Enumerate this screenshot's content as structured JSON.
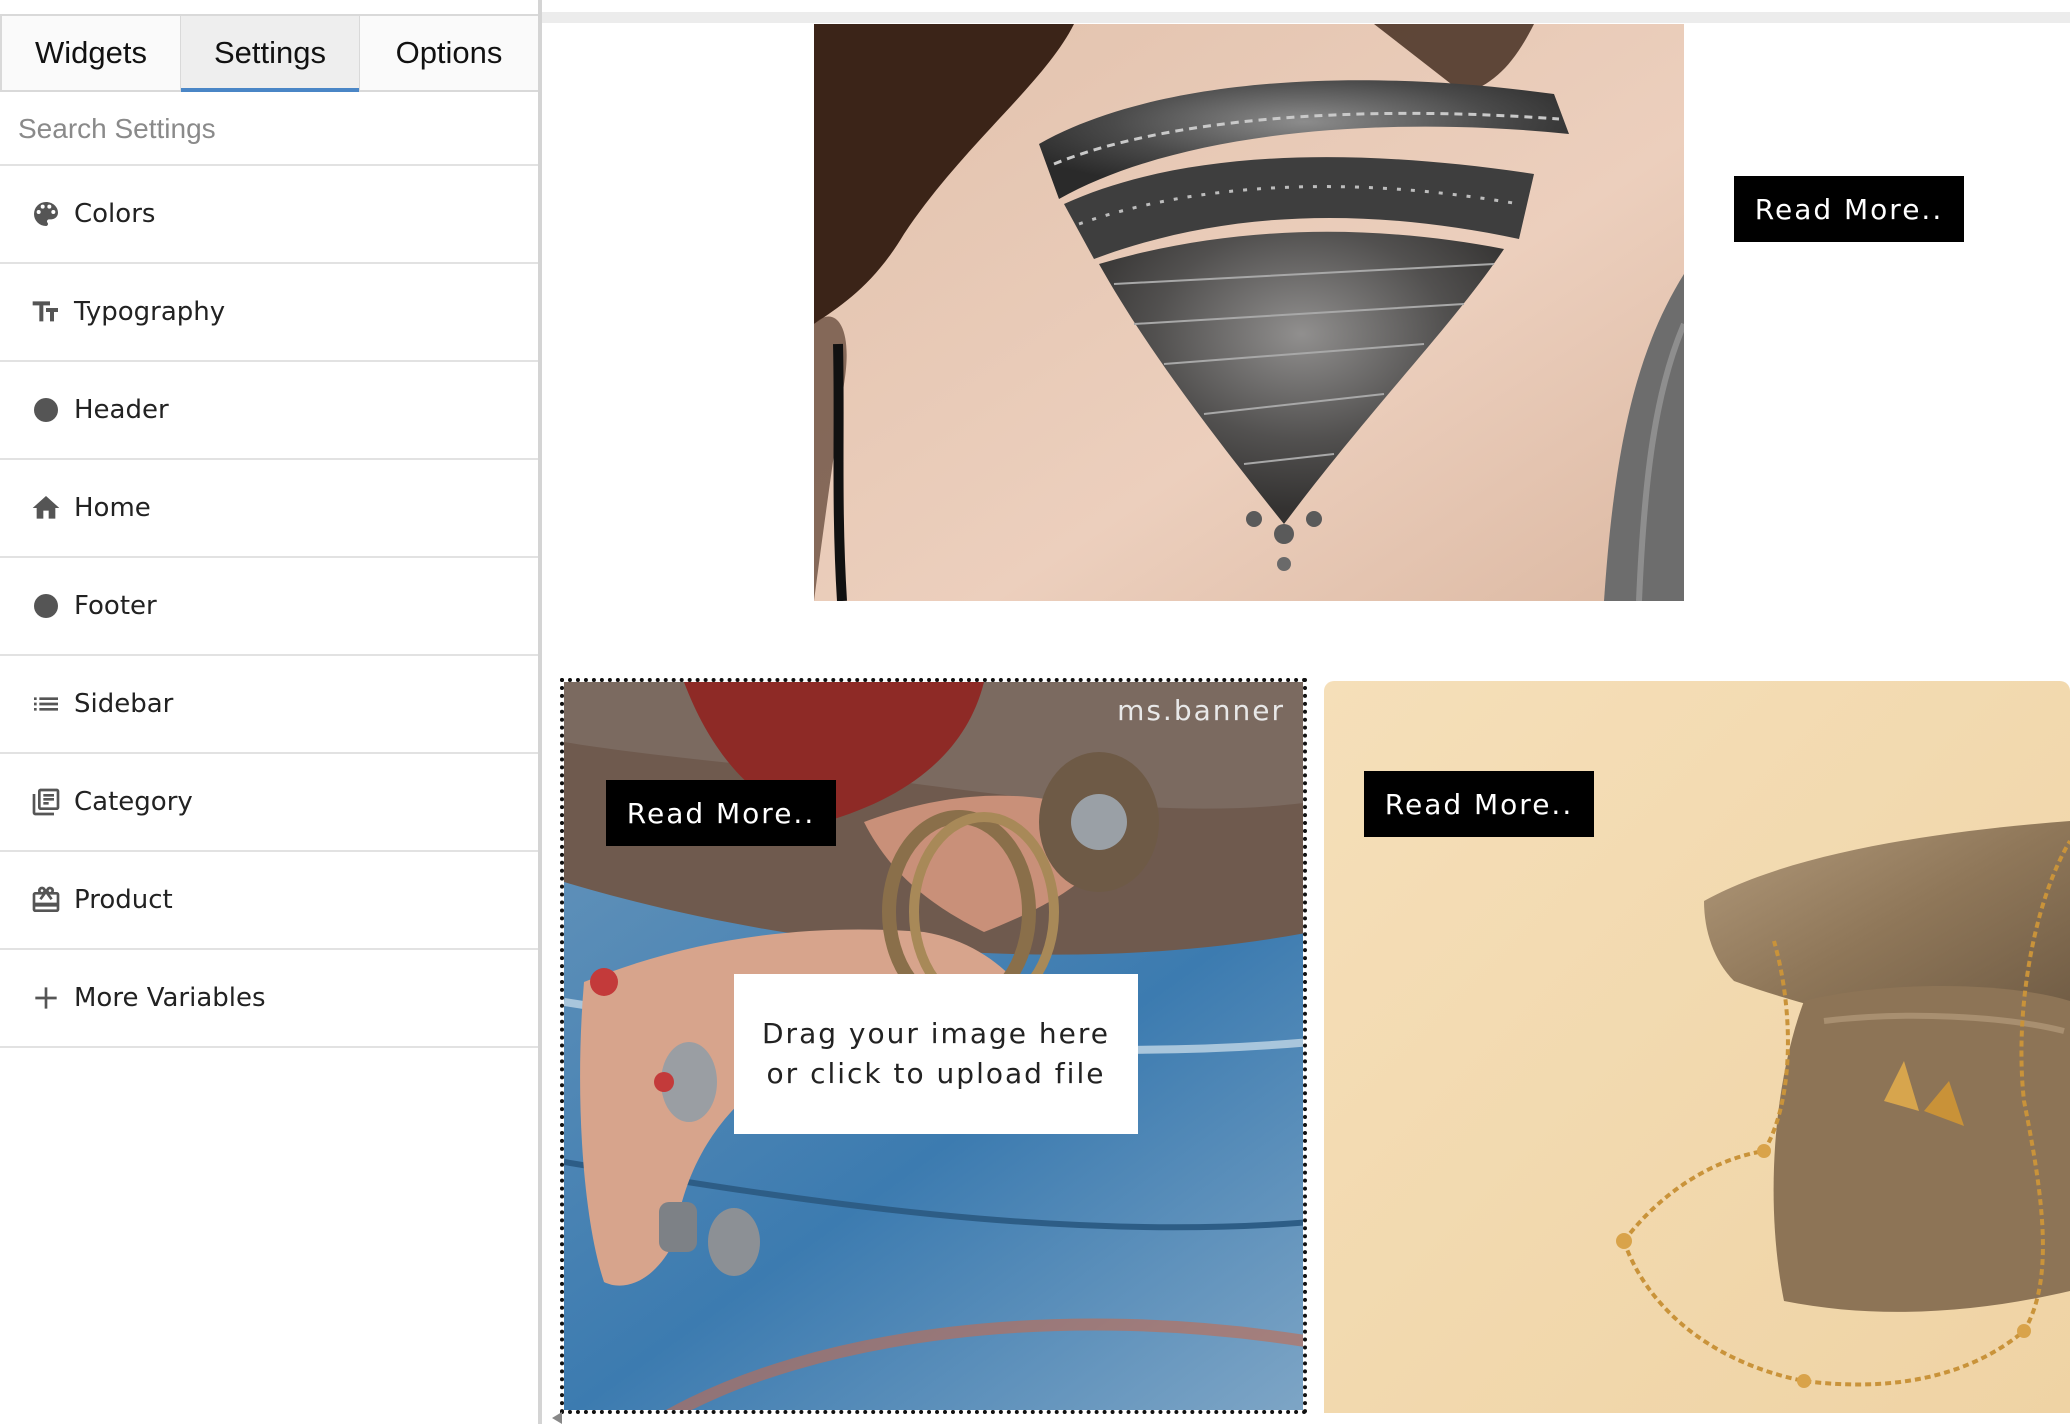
{
  "tabs": [
    {
      "label": "Widgets",
      "active": false
    },
    {
      "label": "Settings",
      "active": true
    },
    {
      "label": "Options",
      "active": false
    }
  ],
  "search": {
    "placeholder": "Search Settings",
    "value": ""
  },
  "menu": [
    {
      "label": "Colors",
      "icon": "palette-icon"
    },
    {
      "label": "Typography",
      "icon": "typography-icon"
    },
    {
      "label": "Header",
      "icon": "circle-icon"
    },
    {
      "label": "Home",
      "icon": "home-icon"
    },
    {
      "label": "Footer",
      "icon": "circle-icon"
    },
    {
      "label": "Sidebar",
      "icon": "list-icon"
    },
    {
      "label": "Category",
      "icon": "library-icon"
    },
    {
      "label": "Product",
      "icon": "product-box-icon"
    },
    {
      "label": "More Variables",
      "icon": "plus-icon"
    }
  ],
  "canvas": {
    "hero": {
      "button": "Read More.."
    },
    "banner": {
      "tag": "ms.banner",
      "button": "Read More..",
      "upload_line1": "Drag your image here",
      "upload_line2": "or click to upload file"
    },
    "side_banner": {
      "button": "Read More.."
    }
  },
  "colors": {
    "tab_accent": "#4a86c6",
    "button_bg": "#000000",
    "button_text": "#ffffff",
    "icon_gray": "#555555"
  }
}
